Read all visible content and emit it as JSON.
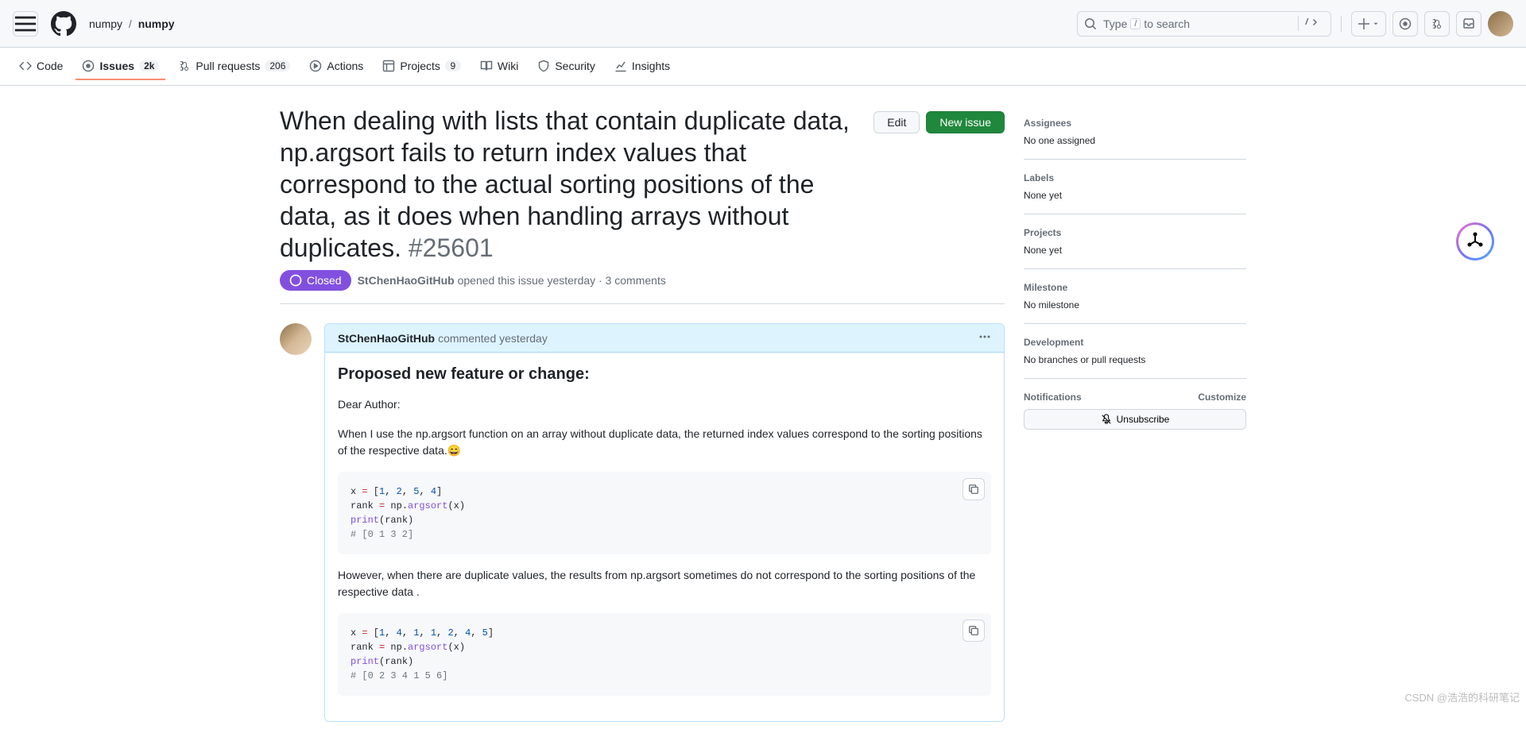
{
  "header": {
    "owner": "numpy",
    "repo": "numpy",
    "search_prefix": "Type ",
    "search_key": "/",
    "search_suffix": " to search"
  },
  "nav": {
    "code": "Code",
    "issues": "Issues",
    "issues_count": "2k",
    "pulls": "Pull requests",
    "pulls_count": "206",
    "actions": "Actions",
    "projects": "Projects",
    "projects_count": "9",
    "wiki": "Wiki",
    "security": "Security",
    "insights": "Insights"
  },
  "issue": {
    "title": "When dealing with lists that contain duplicate data, np.argsort fails to return index values that correspond to the actual sorting positions of the data, as it does when handling arrays without duplicates.",
    "number": "#25601",
    "state": "Closed",
    "author": "StChenHaoGitHub",
    "opened_text": " opened this issue yesterday · 3 comments",
    "edit": "Edit",
    "new_issue": "New issue"
  },
  "comment": {
    "author": "StChenHaoGitHub",
    "when": " commented yesterday",
    "heading": "Proposed new feature or change:",
    "p1": "Dear Author:",
    "p2": "When I use the np.argsort function on an array without duplicate data, the returned index values correspond to the sorting positions of the respective data.😄",
    "p3": "However, when there are duplicate values, the results from np.argsort sometimes do not correspond to the sorting positions of the respective data .",
    "code1": {
      "l1a": "x ",
      "l1b": "=",
      "l1c": " [",
      "l1d": "1",
      "l1e": ", ",
      "l1f": "2",
      "l1g": ", ",
      "l1h": "5",
      "l1i": ", ",
      "l1j": "4",
      "l1k": "]",
      "l2a": "rank ",
      "l2b": "=",
      "l2c": " np.",
      "l2d": "argsort",
      "l2e": "(x)",
      "l3a": "print",
      "l3b": "(rank)",
      "l4": "# [0 1 3 2]"
    },
    "code2": {
      "l1a": "x ",
      "l1b": "=",
      "l1c": " [",
      "l1d": "1",
      "l1e": ", ",
      "l1f": "4",
      "l1g": ", ",
      "l1h": "1",
      "l1i": ", ",
      "l1j": "1",
      "l1k": ", ",
      "l1l": "2",
      "l1m": ", ",
      "l1n": "4",
      "l1o": ", ",
      "l1p": "5",
      "l1q": "]",
      "l2a": "rank ",
      "l2b": "=",
      "l2c": " np.",
      "l2d": "argsort",
      "l2e": "(x)",
      "l3a": "print",
      "l3b": "(rank)",
      "l4": "# [0 2 3 4 1 5 6]"
    }
  },
  "sidebar": {
    "assignees_h": "Assignees",
    "assignees_v": "No one assigned",
    "labels_h": "Labels",
    "labels_v": "None yet",
    "projects_h": "Projects",
    "projects_v": "None yet",
    "milestone_h": "Milestone",
    "milestone_v": "No milestone",
    "dev_h": "Development",
    "dev_v": "No branches or pull requests",
    "notif_h": "Notifications",
    "customize": "Customize",
    "unsubscribe": "Unsubscribe"
  },
  "watermark": "CSDN @浩浩的科研笔记"
}
